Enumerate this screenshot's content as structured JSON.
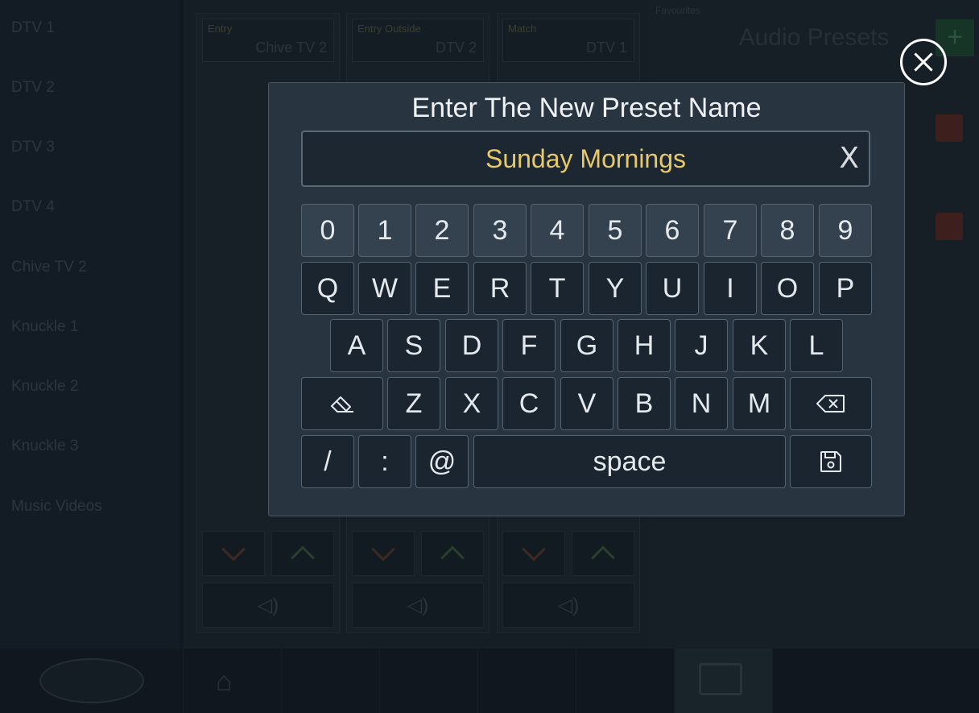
{
  "background": {
    "sidebar_items": [
      "DTV 1",
      "DTV 2",
      "DTV 3",
      "DTV 4",
      "Chive TV 2",
      "Knuckle 1",
      "Knuckle 2",
      "Knuckle 3",
      "Music Videos"
    ],
    "columns": [
      {
        "tag": "Entry",
        "source": "Chive TV 2"
      },
      {
        "tag": "Entry Outside",
        "source": "DTV 2"
      },
      {
        "tag": "Match",
        "source": "DTV 1"
      }
    ],
    "right_panel": {
      "small_label": "Favourites",
      "title": "Audio Presets",
      "add_label": "+"
    }
  },
  "dialog": {
    "title": "Enter The New Preset Name",
    "input_value": "Sunday Mornings",
    "clear_label": "X",
    "close_icon": "close-circle-icon"
  },
  "keyboard": {
    "row_numbers": [
      "0",
      "1",
      "2",
      "3",
      "4",
      "5",
      "6",
      "7",
      "8",
      "9"
    ],
    "row_top": [
      "Q",
      "W",
      "E",
      "R",
      "T",
      "Y",
      "U",
      "I",
      "O",
      "P"
    ],
    "row_middle": [
      "A",
      "S",
      "D",
      "F",
      "G",
      "H",
      "J",
      "K",
      "L"
    ],
    "row_bottom_letters": [
      "Z",
      "X",
      "C",
      "V",
      "B",
      "N",
      "M"
    ],
    "row_symbols": [
      "/",
      ":",
      "@"
    ],
    "space_label": "space",
    "clear_all_icon": "eraser-icon",
    "backspace_icon": "backspace-icon",
    "save_icon": "save-icon"
  }
}
